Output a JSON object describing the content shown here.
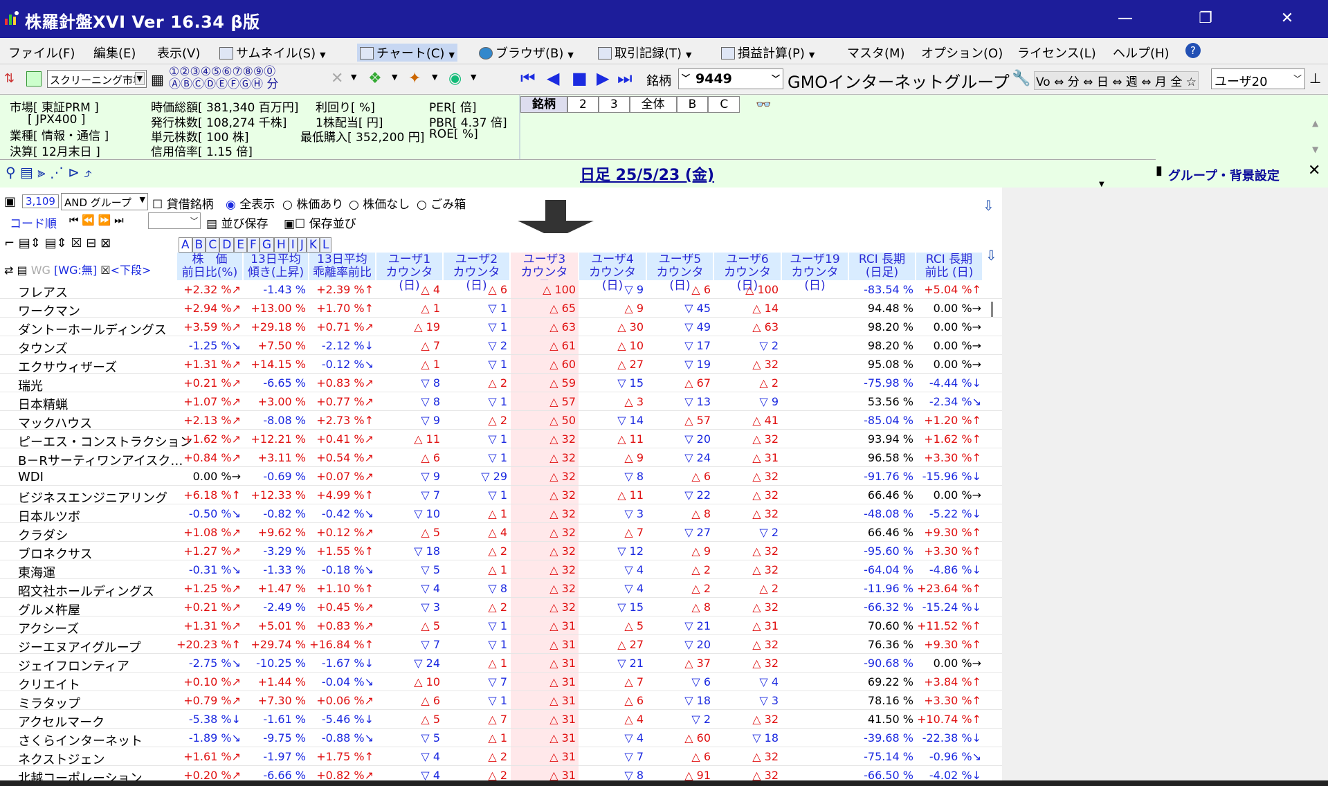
{
  "window": {
    "title": "株羅針盤XVI Ver 16.34 β版"
  },
  "menu": [
    {
      "label": "ファイル(F)"
    },
    {
      "label": "編集(E)"
    },
    {
      "label": "表示(V)"
    },
    {
      "label": "サムネイル(S)"
    },
    {
      "label": "チャート(C)"
    },
    {
      "label": "ブラウザ(B)"
    },
    {
      "label": "取引記録(T)"
    },
    {
      "label": "損益計算(P)"
    },
    {
      "label": "マスタ(M)"
    },
    {
      "label": "オプション(O)"
    },
    {
      "label": "ライセンス(L)"
    },
    {
      "label": "ヘルプ(H)"
    }
  ],
  "toolbar": {
    "market_select": "スクリーニング市場",
    "num_row1": "①②③④⑤⑥⑦⑧⑨⓪",
    "num_row2": "ⒶⒷⒸⒹⒺⒻⒼⒽ 分",
    "meigara_label": "銘柄",
    "code": "9449",
    "company": "GMOインターネットグループ",
    "period_btns": "Vo ⇔ 分 ⇔ 日 ⇔ 週 ⇔ 月 全 ☆",
    "user": "ユーザ20"
  },
  "info": {
    "market": "市場[ 東証PRM ]",
    "index": "[ JPX400 ]",
    "sector": "業種[ 情報・通信 ]",
    "settle": "決算[ 12月末日 ]",
    "mcap": "時価総額[ 381,340 百万円]",
    "shares": "発行株数[ 108,274 千株]",
    "unit": "単元株数[ 100 株]",
    "margin": "信用倍率[ 1.15 倍]",
    "yield": "利回り[ %]",
    "div": "1株配当[ 円]",
    "minbuy": "最低購入[ 352,200 円]",
    "per": "PER[ 倍]",
    "pbr": "PBR[ 4.37 倍]",
    "roe": "ROE[ %]"
  },
  "tabs": [
    "銘柄",
    "2",
    "3",
    "全体",
    "B",
    "C"
  ],
  "chart": {
    "date": "日足 25/5/23 (金)",
    "side_title": "グループ・背景設定"
  },
  "controls": {
    "count": "3,109",
    "group": "AND グループ",
    "filter_lend": "貸借銘柄",
    "opt_all": "全表示",
    "opt_price": "株価あり",
    "opt_noprice": "株価なし",
    "opt_trash": "ごみ箱",
    "sort_label": "コード順",
    "save_order": "並び保存",
    "saved_order": "保存並び",
    "letters": [
      "A",
      "B",
      "C",
      "D",
      "E",
      "F",
      "G",
      "H",
      "I",
      "J",
      "K",
      "L"
    ],
    "wg": "WG",
    "wg_none": "[WG:無]",
    "lower": "<下段>"
  },
  "columns": [
    {
      "l1": "株　価",
      "l2": "前日比(%)"
    },
    {
      "l1": "13日平均",
      "l2": "傾き(上昇)"
    },
    {
      "l1": "13日平均",
      "l2": "乖離率前比"
    },
    {
      "l1": "ユーザ1",
      "l2": "カウンタ(日)"
    },
    {
      "l1": "ユーザ2",
      "l2": "カウンタ(日)"
    },
    {
      "l1": "ユーザ3",
      "l2": "カウンタ(日)"
    },
    {
      "l1": "ユーザ4",
      "l2": "カウンタ(日)"
    },
    {
      "l1": "ユーザ5",
      "l2": "カウンタ(日)"
    },
    {
      "l1": "ユーザ6",
      "l2": "カウンタ(日)"
    },
    {
      "l1": "ユーザ19",
      "l2": "カウンタ(日)"
    },
    {
      "l1": "RCI 長期",
      "l2": "(日足)"
    },
    {
      "l1": "RCI 長期",
      "l2": "前比 (日)"
    }
  ],
  "rows": [
    {
      "n": "フレアス",
      "c": [
        "+2.32 %↗",
        "-1.43 %",
        "+2.39 %↑",
        "△ 4",
        "△ 6",
        "△ 100",
        "▽ 9",
        "△ 6",
        "△ 100",
        "",
        "-83.54 %",
        "+5.04 %↑"
      ]
    },
    {
      "n": "ワークマン",
      "c": [
        "+2.94 %↗",
        "+13.00 %",
        "+1.70 %↑",
        "△ 1",
        "▽ 1",
        "△ 65",
        "△ 9",
        "▽ 45",
        "△ 14",
        "",
        "94.48 %",
        "0.00 %→"
      ]
    },
    {
      "n": "ダントーホールディングス",
      "c": [
        "+3.59 %↗",
        "+29.18 %",
        "+0.71 %↗",
        "△ 19",
        "▽ 1",
        "△ 63",
        "△ 30",
        "▽ 49",
        "△ 63",
        "",
        "98.20 %",
        "0.00 %→"
      ]
    },
    {
      "n": "タウンズ",
      "c": [
        "-1.25 %↘",
        "+7.50 %",
        "-2.12 %↓",
        "△ 7",
        "▽ 2",
        "△ 61",
        "△ 10",
        "▽ 17",
        "▽ 2",
        "",
        "98.20 %",
        "0.00 %→"
      ]
    },
    {
      "n": "エクサウィザーズ",
      "c": [
        "+1.31 %↗",
        "+14.15 %",
        "-0.12 %↘",
        "△ 1",
        "▽ 1",
        "△ 60",
        "△ 27",
        "▽ 19",
        "△ 32",
        "",
        "95.08 %",
        "0.00 %→"
      ]
    },
    {
      "n": "瑞光",
      "c": [
        "+0.21 %↗",
        "-6.65 %",
        "+0.83 %↗",
        "▽ 8",
        "△ 2",
        "△ 59",
        "▽ 15",
        "△ 67",
        "△ 2",
        "",
        "-75.98 %",
        "-4.44 %↓"
      ]
    },
    {
      "n": "日本精蝋",
      "c": [
        "+1.07 %↗",
        "+3.00 %",
        "+0.77 %↗",
        "▽ 8",
        "▽ 1",
        "△ 57",
        "△ 3",
        "▽ 13",
        "▽ 9",
        "",
        "53.56 %",
        "-2.34 %↘"
      ]
    },
    {
      "n": "マックハウス",
      "c": [
        "+2.13 %↗",
        "-8.08 %",
        "+2.73 %↑",
        "▽ 9",
        "△ 2",
        "△ 50",
        "▽ 14",
        "△ 57",
        "△ 41",
        "",
        "-85.04 %",
        "+1.20 %↑"
      ]
    },
    {
      "n": "ピーエス・コンストラクション",
      "c": [
        "+1.62 %↗",
        "+12.21 %",
        "+0.41 %↗",
        "△ 11",
        "▽ 1",
        "△ 32",
        "△ 11",
        "▽ 20",
        "△ 32",
        "",
        "93.94 %",
        "+1.62 %↑"
      ]
    },
    {
      "n": "B－Rサーティワンアイスク…",
      "c": [
        "+0.84 %↗",
        "+3.11 %",
        "+0.54 %↗",
        "△ 6",
        "▽ 1",
        "△ 32",
        "△ 9",
        "▽ 24",
        "△ 31",
        "",
        "96.58 %",
        "+3.30 %↑"
      ]
    },
    {
      "n": "WDI",
      "c": [
        "0.00 %→",
        "-0.69 %",
        "+0.07 %↗",
        "▽ 9",
        "▽ 29",
        "△ 32",
        "▽ 8",
        "△ 6",
        "△ 32",
        "",
        "-91.76 %",
        "-15.96 %↓"
      ]
    },
    {
      "n": "ビジネスエンジニアリング",
      "c": [
        "+6.18 %↑",
        "+12.33 %",
        "+4.99 %↑",
        "▽ 7",
        "▽ 1",
        "△ 32",
        "△ 11",
        "▽ 22",
        "△ 32",
        "",
        "66.46 %",
        "0.00 %→"
      ]
    },
    {
      "n": "日本ルツボ",
      "c": [
        "-0.50 %↘",
        "-0.82 %",
        "-0.42 %↘",
        "▽ 10",
        "△ 1",
        "△ 32",
        "▽ 3",
        "△ 8",
        "△ 32",
        "",
        "-48.08 %",
        "-5.22 %↓"
      ]
    },
    {
      "n": "クラダシ",
      "c": [
        "+1.08 %↗",
        "+9.62 %",
        "+0.12 %↗",
        "△ 5",
        "△ 4",
        "△ 32",
        "△ 7",
        "▽ 27",
        "▽ 2",
        "",
        "66.46 %",
        "+9.30 %↑"
      ]
    },
    {
      "n": "ブロネクサス",
      "c": [
        "+1.27 %↗",
        "-3.29 %",
        "+1.55 %↑",
        "▽ 18",
        "△ 2",
        "△ 32",
        "▽ 12",
        "△ 9",
        "△ 32",
        "",
        "-95.60 %",
        "+3.30 %↑"
      ]
    },
    {
      "n": "東海運",
      "c": [
        "-0.31 %↘",
        "-1.33 %",
        "-0.18 %↘",
        "▽ 5",
        "△ 1",
        "△ 32",
        "▽ 4",
        "△ 2",
        "△ 32",
        "",
        "-64.04 %",
        "-4.86 %↓"
      ]
    },
    {
      "n": "昭文社ホールディングス",
      "c": [
        "+1.25 %↗",
        "+1.47 %",
        "+1.10 %↑",
        "▽ 4",
        "▽ 8",
        "△ 32",
        "▽ 4",
        "△ 2",
        "△ 2",
        "",
        "-11.96 %",
        "+23.64 %↑"
      ]
    },
    {
      "n": "グルメ杵屋",
      "c": [
        "+0.21 %↗",
        "-2.49 %",
        "+0.45 %↗",
        "▽ 3",
        "△ 2",
        "△ 32",
        "▽ 15",
        "△ 8",
        "△ 32",
        "",
        "-66.32 %",
        "-15.24 %↓"
      ]
    },
    {
      "n": "アクシーズ",
      "c": [
        "+1.31 %↗",
        "+5.01 %",
        "+0.83 %↗",
        "△ 5",
        "▽ 1",
        "△ 31",
        "△ 5",
        "▽ 21",
        "△ 31",
        "",
        "70.60 %",
        "+11.52 %↑"
      ]
    },
    {
      "n": "ジーエヌアイグループ",
      "c": [
        "+20.23 %↑",
        "+29.74 %",
        "+16.84 %↑",
        "▽ 7",
        "▽ 1",
        "△ 31",
        "△ 27",
        "▽ 20",
        "△ 32",
        "",
        "76.36 %",
        "+9.30 %↑"
      ]
    },
    {
      "n": "ジェイフロンティア",
      "c": [
        "-2.75 %↘",
        "-10.25 %",
        "-1.67 %↓",
        "▽ 24",
        "△ 1",
        "△ 31",
        "▽ 21",
        "△ 37",
        "△ 32",
        "",
        "-90.68 %",
        "0.00 %→"
      ]
    },
    {
      "n": "クリエイト",
      "c": [
        "+0.10 %↗",
        "+1.44 %",
        "-0.04 %↘",
        "△ 10",
        "▽ 7",
        "△ 31",
        "△ 7",
        "▽ 6",
        "▽ 4",
        "",
        "69.22 %",
        "+3.84 %↑"
      ]
    },
    {
      "n": "ミラタップ",
      "c": [
        "+0.79 %↗",
        "+7.30 %",
        "+0.06 %↗",
        "△ 6",
        "▽ 1",
        "△ 31",
        "△ 6",
        "▽ 18",
        "▽ 3",
        "",
        "78.16 %",
        "+3.30 %↑"
      ]
    },
    {
      "n": "アクセルマーク",
      "c": [
        "-5.38 %↓",
        "-1.61 %",
        "-5.46 %↓",
        "△ 5",
        "△ 7",
        "△ 31",
        "△ 4",
        "▽ 2",
        "△ 32",
        "",
        "41.50 %",
        "+10.74 %↑"
      ]
    },
    {
      "n": "さくらインターネット",
      "c": [
        "-1.89 %↘",
        "-9.75 %",
        "-0.88 %↘",
        "▽ 5",
        "△ 1",
        "△ 31",
        "▽ 4",
        "△ 60",
        "▽ 18",
        "",
        "-39.68 %",
        "-22.38 %↓"
      ]
    },
    {
      "n": "ネクストジェン",
      "c": [
        "+1.61 %↗",
        "-1.97 %",
        "+1.75 %↑",
        "▽ 4",
        "△ 2",
        "△ 31",
        "▽ 7",
        "△ 6",
        "△ 32",
        "",
        "-75.14 %",
        "-0.96 %↘"
      ]
    },
    {
      "n": "北越コーポレーション",
      "c": [
        "+0.20 %↗",
        "-6.66 %",
        "+0.82 %↗",
        "▽ 4",
        "△ 2",
        "△ 31",
        "▽ 8",
        "△ 91",
        "△ 32",
        "",
        "-66.50 %",
        "-4.02 %↓"
      ]
    }
  ]
}
